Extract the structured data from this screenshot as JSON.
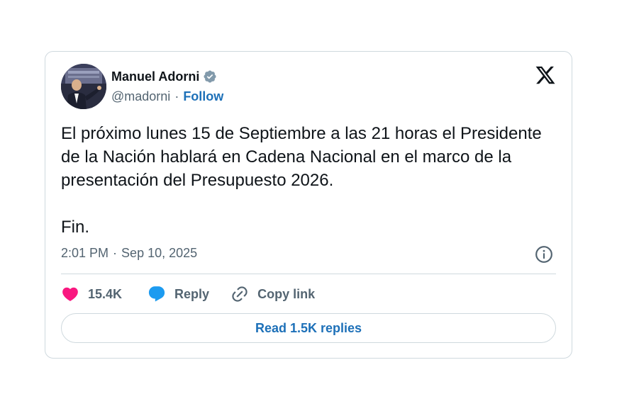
{
  "author": {
    "name": "Manuel Adorni",
    "handle": "@madorni",
    "separator": "·",
    "follow_label": "Follow",
    "verified_color": "#829aab"
  },
  "tweet": {
    "text": "El próximo lunes 15 de Septiembre a las 21 horas el Presidente de la Nación hablará en Cadena Nacional en el marco de la presentación del Presupuesto 2026.\n\nFin.",
    "time": "2:01 PM",
    "separator": "·",
    "date": "Sep 10, 2025"
  },
  "actions": {
    "like_count": "15.4K",
    "reply_label": "Reply",
    "copy_link_label": "Copy link",
    "read_replies_label": "Read 1.5K replies"
  },
  "icons": {
    "like": "heart-icon",
    "reply": "speech-bubble-icon",
    "copy": "link-icon",
    "info": "info-icon",
    "brand": "x-logo-icon"
  },
  "colors": {
    "like": "#f91880",
    "reply": "#1d9bf0",
    "link": "#1d70b8",
    "secondary_text": "#536471",
    "border": "#cfd9de"
  }
}
